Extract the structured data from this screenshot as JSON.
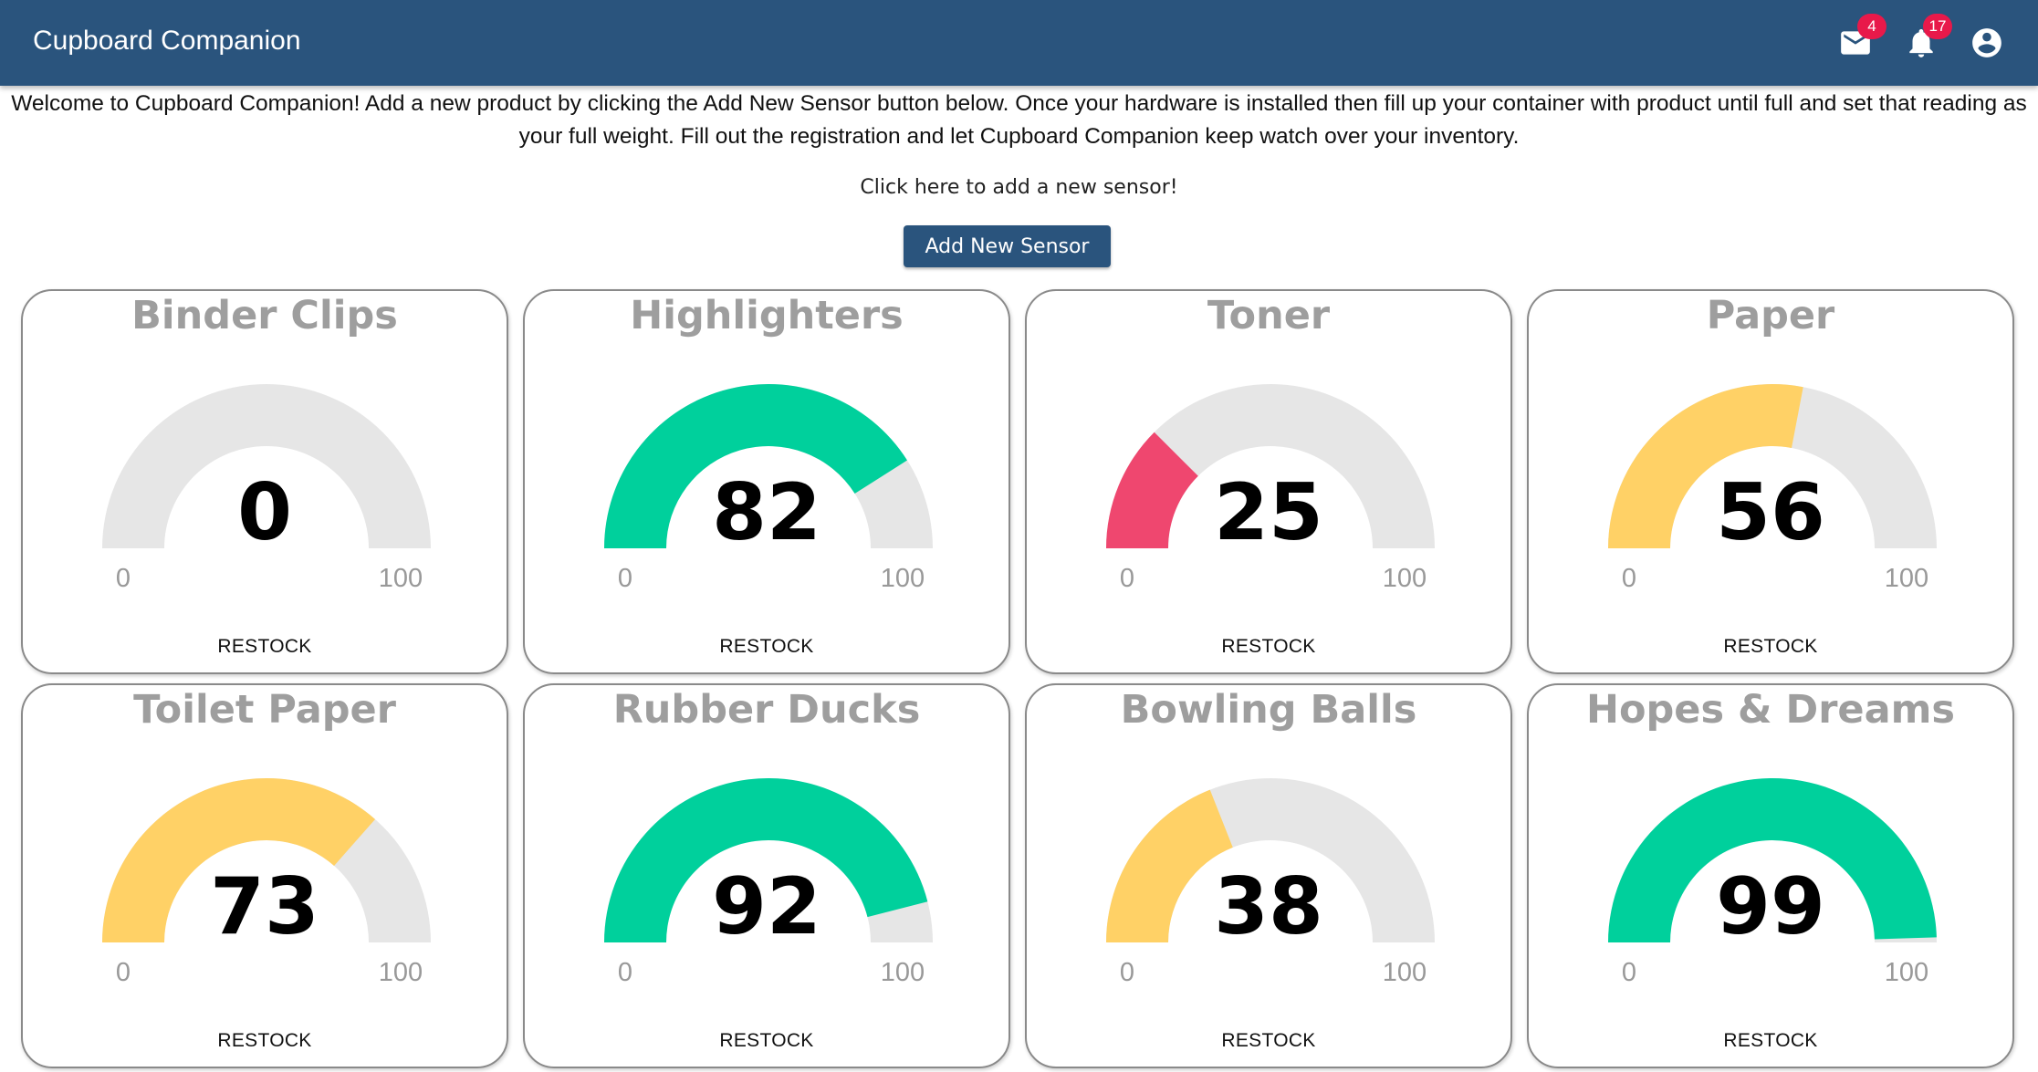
{
  "app": {
    "title": "Cupboard Companion",
    "mail_badge": "4",
    "notifications_badge": "17"
  },
  "icons": {
    "mail": "mail-icon",
    "notifications": "bell-icon",
    "account": "account-circle-icon"
  },
  "colors": {
    "appbar": "#2a547d",
    "gauge_track": "#e6e6e6",
    "gauge_green": "#00d09c",
    "gauge_yellow": "#ffd166",
    "gauge_red": "#ef476f",
    "badge": "#e8194a"
  },
  "welcome_text": "Welcome to Cupboard Companion! Add a new product by clicking the Add New Sensor button below. Once your hardware is installed then fill up your container with product until full and set that reading as your full weight. Fill out the registration and let Cupboard Companion keep watch over your inventory.",
  "add_hint": "Click here to add a new sensor!",
  "add_button_label": "Add New Sensor",
  "sensors": [
    {
      "name": "Binder Clips",
      "value": 0,
      "min": "0",
      "max": "100",
      "action": "RESTOCK"
    },
    {
      "name": "Highlighters",
      "value": 82,
      "min": "0",
      "max": "100",
      "action": "RESTOCK"
    },
    {
      "name": "Toner",
      "value": 25,
      "min": "0",
      "max": "100",
      "action": "RESTOCK"
    },
    {
      "name": "Paper",
      "value": 56,
      "min": "0",
      "max": "100",
      "action": "RESTOCK"
    },
    {
      "name": "Toilet Paper",
      "value": 73,
      "min": "0",
      "max": "100",
      "action": "RESTOCK"
    },
    {
      "name": "Rubber Ducks",
      "value": 92,
      "min": "0",
      "max": "100",
      "action": "RESTOCK"
    },
    {
      "name": "Bowling Balls",
      "value": 38,
      "min": "0",
      "max": "100",
      "action": "RESTOCK"
    },
    {
      "name": "Hopes & Dreams",
      "value": 99,
      "min": "0",
      "max": "100",
      "action": "RESTOCK"
    }
  ]
}
